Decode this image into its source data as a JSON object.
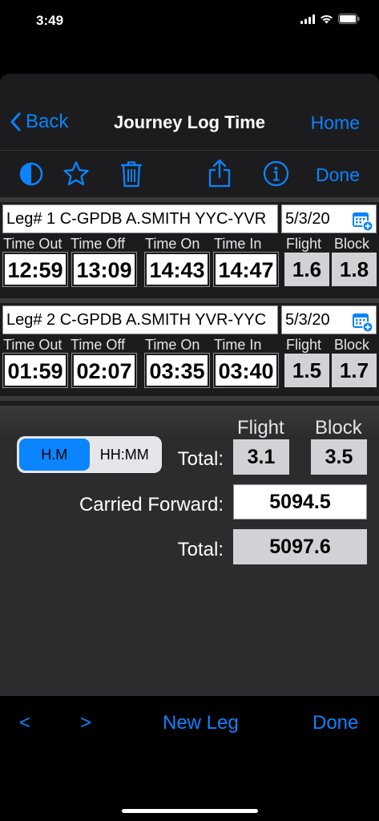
{
  "status_bar": {
    "time": "3:49"
  },
  "nav": {
    "back_label": "Back",
    "title": "Journey Log Time",
    "home_label": "Home"
  },
  "toolbar": {
    "done_label": "Done"
  },
  "columns": {
    "time_out": "Time Out",
    "time_off": "Time Off",
    "time_on": "Time On",
    "time_in": "Time In",
    "flight": "Flight",
    "block": "Block"
  },
  "legs": [
    {
      "description": "Leg# 1 C-GPDB A.SMITH YYC-YVR",
      "date": "5/3/20",
      "time_out": "12:59",
      "time_off": "13:09",
      "time_on": "14:43",
      "time_in": "14:47",
      "flight": "1.6",
      "block": "1.8"
    },
    {
      "description": "Leg# 2 C-GPDB A.SMITH YVR-YYC",
      "date": "5/3/20",
      "time_out": "01:59",
      "time_off": "02:07",
      "time_on": "03:35",
      "time_in": "03:40",
      "flight": "1.5",
      "block": "1.7"
    }
  ],
  "totals": {
    "format_options": [
      "H.M",
      "HH:MM"
    ],
    "selected_format": "H.M",
    "flight_header": "Flight",
    "block_header": "Block",
    "total_label": "Total:",
    "flight_total": "3.1",
    "block_total": "3.5",
    "carried_forward_label": "Carried Forward:",
    "carried_forward": "5094.5",
    "grand_total_label": "Total:",
    "grand_total": "5097.6"
  },
  "bottom_bar": {
    "prev_label": "<",
    "next_label": ">",
    "new_leg_label": "New Leg",
    "done_label": "Done"
  },
  "colors": {
    "accent": "#0a84ff",
    "background": "#1c1c1e",
    "panel": "#2c2c2e",
    "gray_box": "#d1d1d6"
  },
  "icons": [
    "contrast-icon",
    "star-icon",
    "trash-icon",
    "share-icon",
    "info-icon",
    "calendar-add-icon",
    "chevron-left-icon",
    "wifi-icon",
    "battery-icon",
    "signal-icon"
  ]
}
